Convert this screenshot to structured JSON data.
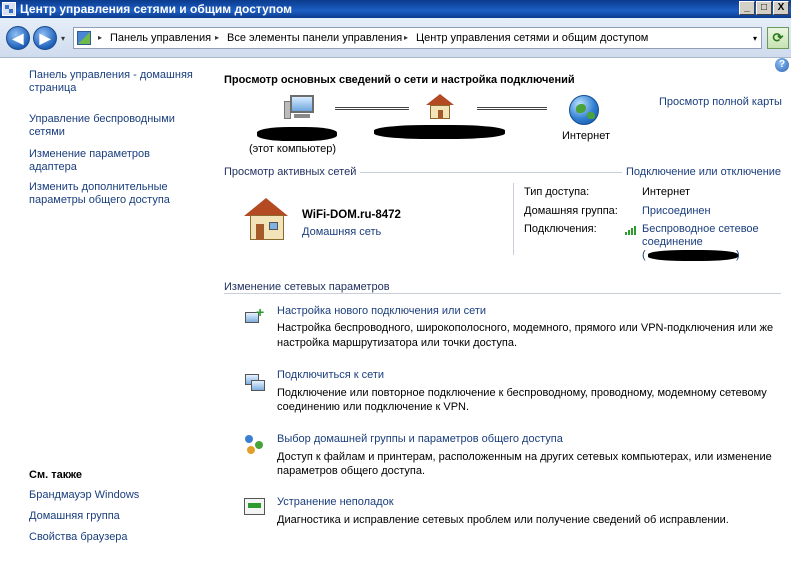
{
  "window": {
    "title": "Центр управления сетями и общим доступом",
    "min_label": "_",
    "max_label": "□",
    "close_label": "X"
  },
  "nav": {
    "back_glyph": "◀",
    "forward_glyph": "▶",
    "dropdown_glyph": "▾",
    "breadcrumbs": [
      "Панель управления",
      "Все элементы панели управления",
      "Центр управления сетями и общим доступом"
    ],
    "sep_glyph": "▸",
    "refresh_glyph": "⟳"
  },
  "help_label": "?",
  "sidebar": {
    "items": [
      {
        "label": "Панель управления - домашняя"
      },
      {
        "label": "страница"
      },
      {
        "label": "Управление беспроводными"
      },
      {
        "label": "сетями"
      },
      {
        "label": "Изменение параметров"
      },
      {
        "label": "адаптера"
      },
      {
        "label": "Изменить дополнительные"
      },
      {
        "label": "параметры общего доступа"
      }
    ],
    "see_also_title": "См. также",
    "see_also": [
      {
        "label": "Брандмауэр Windows"
      },
      {
        "label": "Домашняя группа"
      },
      {
        "label": "Свойства браузера"
      }
    ]
  },
  "main": {
    "title": "Просмотр основных сведений о сети и настройка подключений",
    "full_map_link": "Просмотр полной карты",
    "map": {
      "computer_label": "(этот компьютер)",
      "internet_label": "Интернет"
    },
    "active_networks_header": "Просмотр активных сетей",
    "connect_disconnect_link": "Подключение или отключение",
    "network": {
      "name": "WiFi-DOM.ru-8472",
      "type": "Домашняя сеть"
    },
    "details": [
      {
        "label": "Тип доступа:",
        "value": "Интернет"
      },
      {
        "label": "Домашняя группа:",
        "value": "Присоединен"
      },
      {
        "label": "Подключения:",
        "value_line1": "Беспроводное сетевое",
        "value_line2": "соединение",
        "value_line3": "(",
        "value_line3_end": ")"
      }
    ],
    "change_settings_header": "Изменение сетевых параметров",
    "tasks": [
      {
        "title": "Настройка нового подключения или сети",
        "desc1": "Настройка беспроводного, широкополосного, модемного, прямого или VPN-подключения или же",
        "desc2": "настройка маршрутизатора или точки доступа."
      },
      {
        "title": "Подключиться к сети",
        "desc1": "Подключение или повторное подключение к беспроводному, проводному, модемному сетевому",
        "desc2": "соединению или подключение к VPN."
      },
      {
        "title": "Выбор домашней группы и параметров общего доступа",
        "desc1": "Доступ к файлам и принтерам, расположенным на других сетевых компьютерах, или изменение",
        "desc2": "параметров общего доступа."
      },
      {
        "title": "Устранение неполадок",
        "desc1": "Диагностика и исправление сетевых проблем или получение сведений об исправлении.",
        "desc2": ""
      }
    ]
  },
  "colors": {
    "link": "#1a3e7d",
    "titlebar": "#1d5fc4",
    "signal": "#2d9a2d"
  }
}
